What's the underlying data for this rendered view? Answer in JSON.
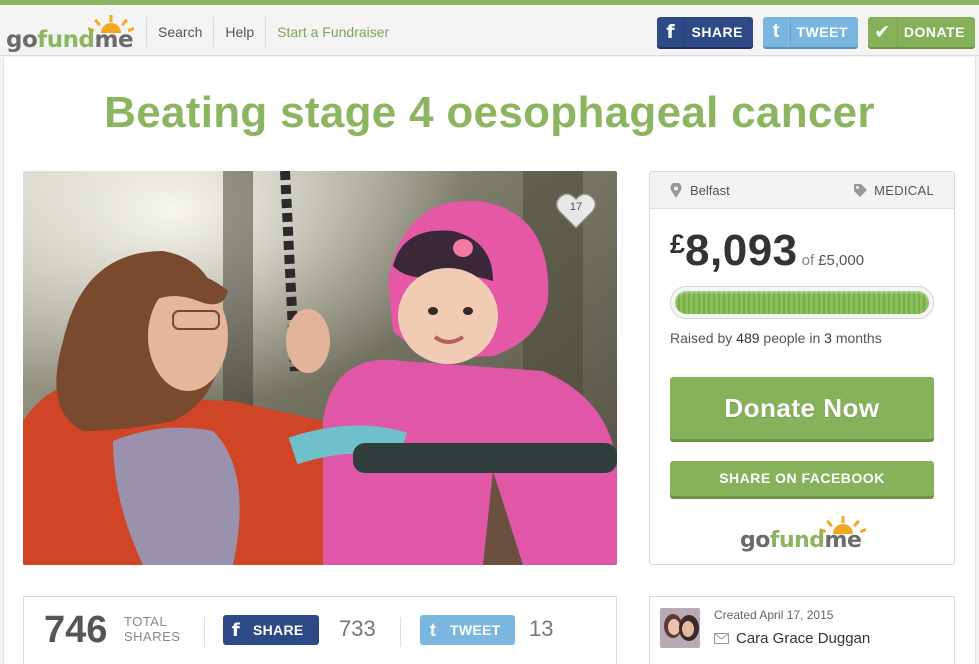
{
  "header": {
    "logo": "gofundme",
    "nav": [
      "Search",
      "Help",
      "Start a Fundraiser"
    ],
    "buttons": {
      "share": "SHARE",
      "tweet": "TWEET",
      "donate": "DONATE"
    }
  },
  "campaign": {
    "title": "Beating stage 4 oesophageal cancer",
    "hearts": "17",
    "location": "Belfast",
    "category": "MEDICAL",
    "currency": "£",
    "raised": "8,093",
    "of_label": "of",
    "goal": "£5,000",
    "progress_fraction": 1.0,
    "raised_by_prefix": "Raised by",
    "people_count": "489",
    "people_label": "people in",
    "months_count": "3",
    "months_label": "months",
    "donate_label": "Donate Now",
    "share_fb_label": "SHARE ON FACEBOOK",
    "footer_logo": "gofundme"
  },
  "shares": {
    "total": "746",
    "total_label_1": "TOTAL",
    "total_label_2": "SHARES",
    "share_label": "SHARE",
    "share_count": "733",
    "tweet_label": "TWEET",
    "tweet_count": "13"
  },
  "creator": {
    "created": "Created April 17, 2015",
    "name": "Cara Grace Duggan"
  },
  "colors": {
    "brand_green": "#8cb560",
    "facebook": "#2d4a86",
    "twitter": "#7ab6df"
  }
}
